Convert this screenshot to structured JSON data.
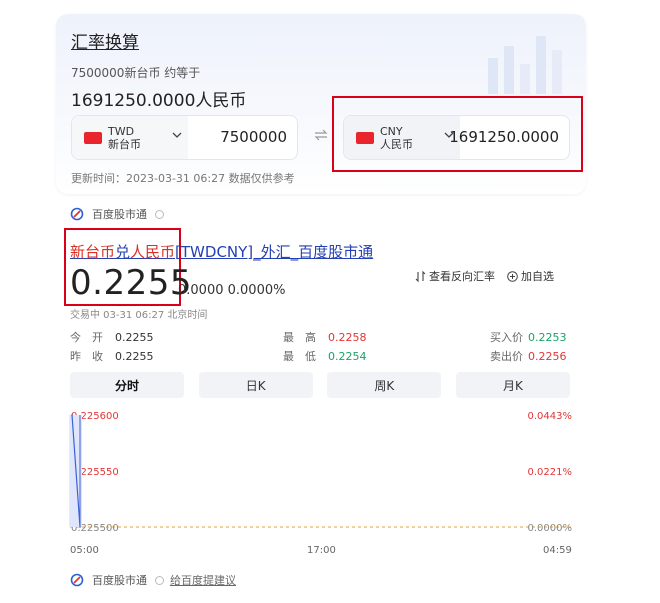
{
  "converter": {
    "title": "汇率换算",
    "subtitle": "7500000新台币 约等于",
    "result": "1691250.0000人民币",
    "from": {
      "code": "TWD",
      "name": "新台币",
      "value": "7500000"
    },
    "to": {
      "code": "CNY",
      "name": "人民币",
      "value": "1691250.0000"
    },
    "update_time": "更新时间：2023-03-31 06:27 数据仅供参考"
  },
  "source": {
    "name": "百度股市通"
  },
  "quote": {
    "link_hl1": "新台币",
    "link_mid": "兑",
    "link_hl2": "人民币",
    "link_rest": "[TWDCNY]_外汇_百度股市通",
    "price": "0.2255",
    "change": "0.0000 0.0000%",
    "reverse_label": "查看反向汇率",
    "add_label": "加自选",
    "trade_time": "交易中  03-31 06:27  北京时间"
  },
  "stats": [
    {
      "label": "今　开",
      "value": "0.2255",
      "tone": "normal"
    },
    {
      "label": "最　高",
      "value": "0.2258",
      "tone": "red"
    },
    {
      "label": "买入价",
      "value": "0.2253",
      "tone": "green"
    },
    {
      "label": "昨　收",
      "value": "0.2255",
      "tone": "normal"
    },
    {
      "label": "最　低",
      "value": "0.2254",
      "tone": "green"
    },
    {
      "label": "卖出价",
      "value": "0.2256",
      "tone": "red"
    }
  ],
  "tabs": [
    "分时",
    "日K",
    "周K",
    "月K"
  ],
  "chart_data": {
    "type": "line",
    "y_left_ticks": [
      "0.225600",
      "0.225550",
      "0.225500"
    ],
    "y_right_ticks": [
      "0.0443%",
      "0.0221%",
      "0.0000%"
    ],
    "x_ticks": [
      "05:00",
      "17:00",
      "04:59"
    ],
    "ylim": [
      0.2255,
      0.2256
    ],
    "series": [
      {
        "values": [
          0.2256,
          0.2255
        ]
      }
    ]
  },
  "footer": {
    "source": "百度股市通",
    "feedback": "给百度提建议"
  },
  "colors": {
    "highlight_frame": "#d9001b",
    "rise": "#e23636",
    "fall": "#1aa267",
    "link": "#2440b3"
  }
}
